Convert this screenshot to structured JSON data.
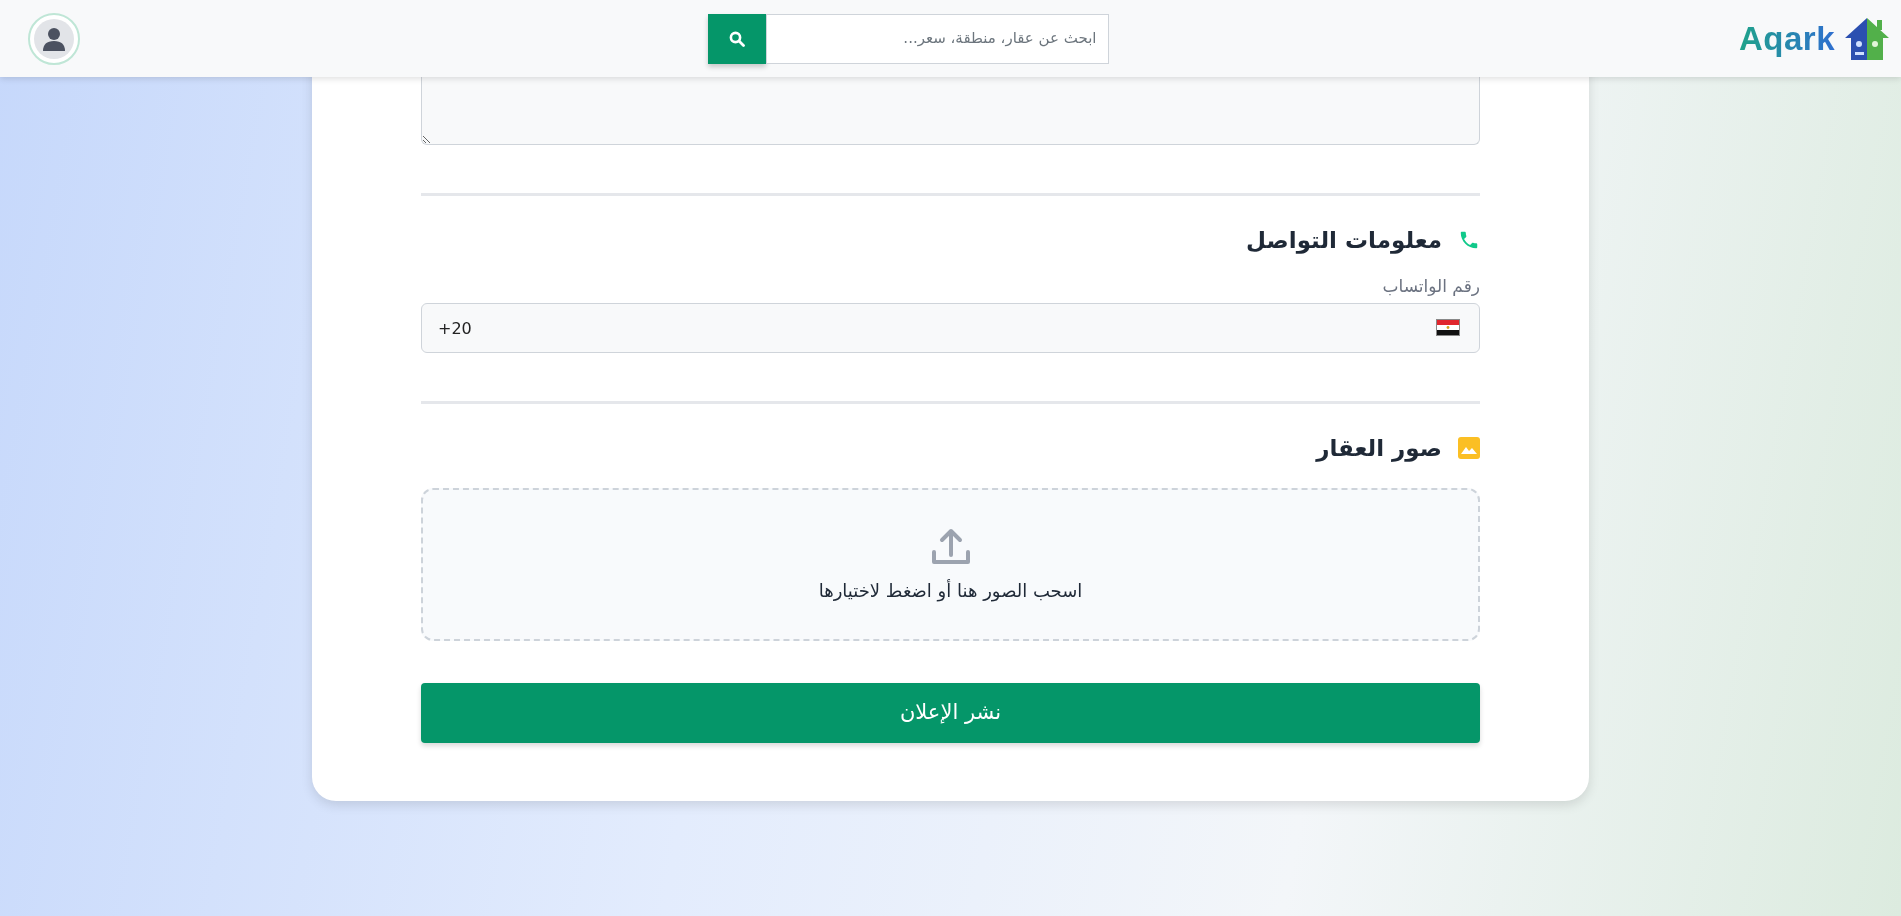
{
  "navbar": {
    "logo_text": "Aqark",
    "search": {
      "placeholder": "ابحث عن عقار، منطقة، سعر..."
    }
  },
  "sections": [
    {
      "kind": "contact",
      "title": "معلومات التواصل",
      "fields": [
        {
          "label": "رقم الواتساب",
          "value": "+20"
        }
      ]
    },
    {
      "kind": "images",
      "title": "صور العقار",
      "dropzone_text": "اسحب الصور هنا أو اضغط لاختيارها"
    }
  ],
  "submit_button": "نشر الإعلان"
}
